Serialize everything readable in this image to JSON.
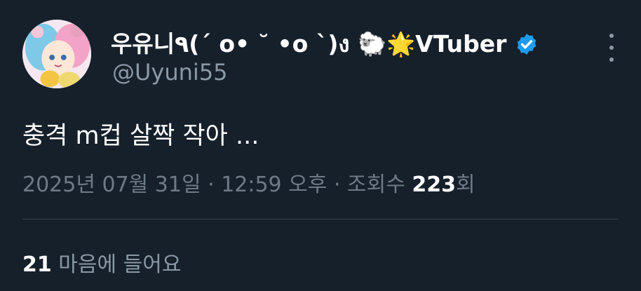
{
  "author": {
    "display_name": "우유니٩(ˊ o• ˘ •o ˋ)ง 🐑🌟VTuber",
    "handle": "@Uyuni55",
    "verified": true
  },
  "tweet": {
    "text": "충격 m컵 살짝 작아 ..."
  },
  "meta": {
    "date": "2025년 07월 31일",
    "sep1": " · ",
    "time": "12:59 오후",
    "sep2": " · ",
    "views_label": "조회수 ",
    "views_count": "223",
    "views_suffix": "회"
  },
  "likes": {
    "count": "21",
    "label": " 마음에 들어요"
  },
  "colors": {
    "background": "#15202b",
    "verified_badge": "#1d9bf0",
    "muted_text": "#8b98a5"
  }
}
